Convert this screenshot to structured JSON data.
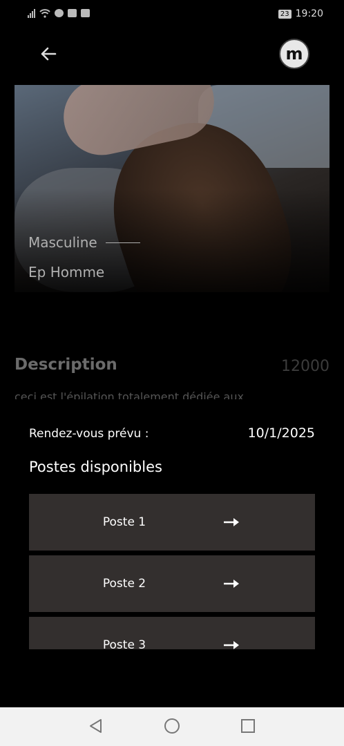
{
  "status_bar": {
    "time": "19:20",
    "battery": "23"
  },
  "app_bar": {
    "logo_letter": "m"
  },
  "hero": {
    "category": "Masculine",
    "title": "Ep Homme"
  },
  "description": {
    "heading": "Description",
    "price": "12000",
    "text": "ceci est l'épilation totalement dédiée aux"
  },
  "booking": {
    "rdv_label": "Rendez-vous prévu :",
    "rdv_date": "10/1/2025",
    "postes_title": "Postes disponibles",
    "postes": [
      {
        "label": "Poste 1"
      },
      {
        "label": "Poste 2"
      },
      {
        "label": "Poste 3"
      }
    ]
  },
  "colors": {
    "background": "#000000",
    "card": "#332f2e",
    "muted_text": "#6b6b6b",
    "nav_bar": "#f2f2f2"
  }
}
